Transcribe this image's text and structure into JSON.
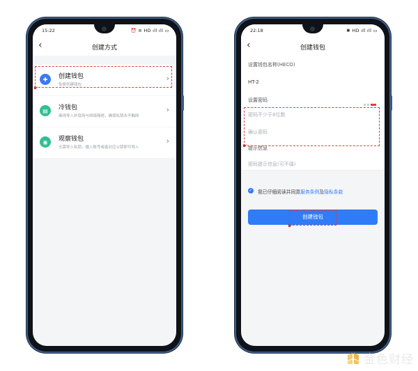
{
  "left": {
    "status": {
      "time": "15:22",
      "icons": "⏰ ≋ HD ıll ıll ▭"
    },
    "nav": {
      "back": "‹",
      "title": "创建方式"
    },
    "options": [
      {
        "title": "创建钱包",
        "subtitle": "免费创建钱包",
        "icon": "wallet-plus-icon",
        "color": "#3b7bf0"
      },
      {
        "title": "冷钱包",
        "subtitle": "离线导入并保持与网络隔绝，确保私钥永不触网",
        "icon": "cold-wallet-icon",
        "color": "#2fbf93"
      },
      {
        "title": "观察钱包",
        "subtitle": "无需导入私钥，输入账号或者对应公钥即可导入",
        "icon": "eye-icon",
        "color": "#2fbf93"
      }
    ]
  },
  "right": {
    "status": {
      "time": "22:18",
      "icons": "✱ HD ıll ıll ▭"
    },
    "nav": {
      "back": "‹",
      "title": "创建钱包"
    },
    "wallet_name_label": "设置钱包名称(HECO)",
    "wallet_name_value": "HT-2",
    "password_label": "设置密码",
    "password_placeholder": "密码不少于8位数",
    "confirm_placeholder": "确认密码",
    "hint_label": "提示信息",
    "hint_placeholder": "密码提示信息(可不填)",
    "agree_prefix": "我已仔细阅读并同意",
    "agree_terms": "服务条例",
    "agree_and": "及",
    "agree_privacy": "隐私条款",
    "submit_label": "创建钱包",
    "accent": "#2f7cf6"
  },
  "watermark": "金色财经"
}
